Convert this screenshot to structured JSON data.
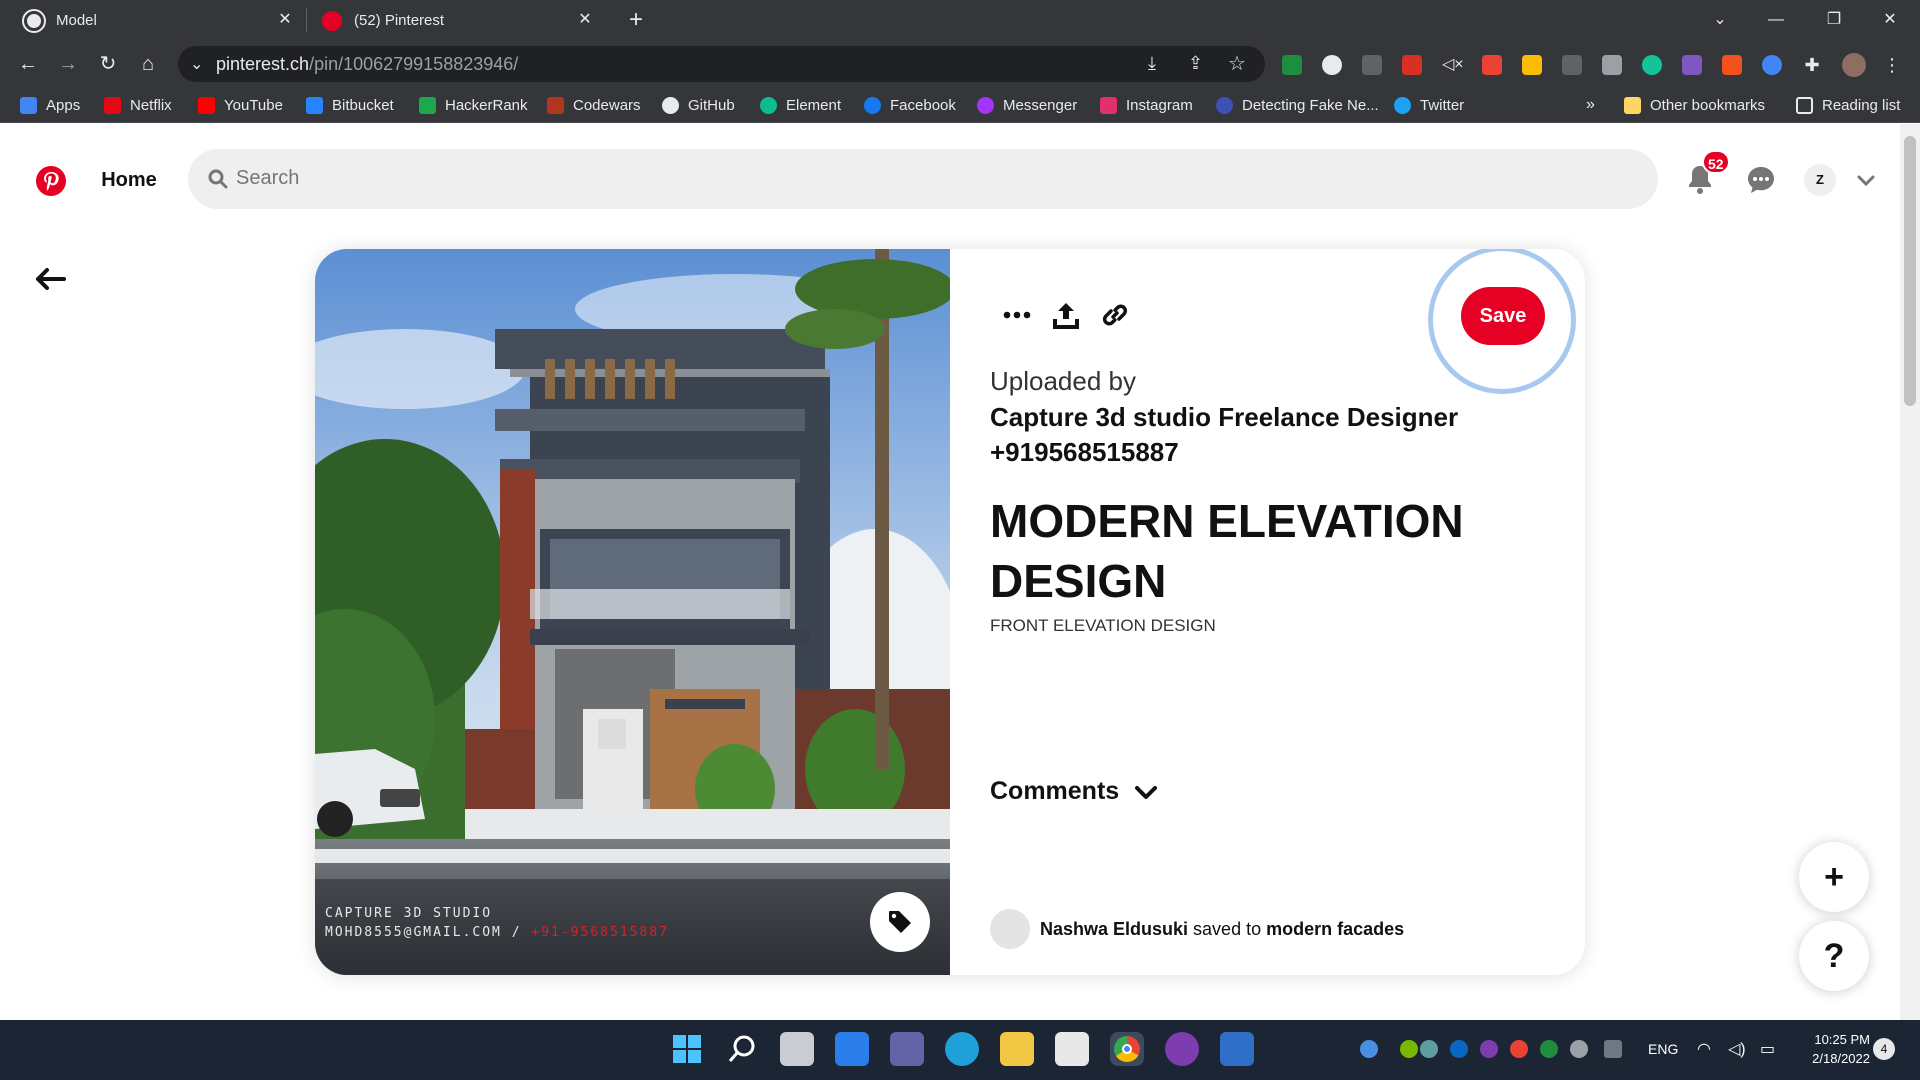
{
  "browser": {
    "tabs": [
      {
        "title": "Model",
        "close": "✕"
      },
      {
        "title": "(52) Pinterest",
        "close": "✕"
      }
    ],
    "new_tab": "+",
    "address": {
      "domain": "pinterest.ch",
      "path": "/pin/10062799158823946/"
    },
    "bookmarks": [
      {
        "label": "Apps",
        "color": "#4285f4"
      },
      {
        "label": "Netflix",
        "color": "#e50914"
      },
      {
        "label": "YouTube",
        "color": "#ff0000"
      },
      {
        "label": "Bitbucket",
        "color": "#2684ff"
      },
      {
        "label": "HackerRank",
        "color": "#1ba94c"
      },
      {
        "label": "Codewars",
        "color": "#b1361e"
      },
      {
        "label": "GitHub",
        "color": "#e8eaed"
      },
      {
        "label": "Element",
        "color": "#0dbd8b"
      },
      {
        "label": "Facebook",
        "color": "#1877f2"
      },
      {
        "label": "Messenger",
        "color": "#a334fa"
      },
      {
        "label": "Instagram",
        "color": "#e1306c"
      },
      {
        "label": "Detecting Fake Ne...",
        "color": "#3f51b5"
      },
      {
        "label": "Twitter",
        "color": "#1da1f2"
      }
    ],
    "more_bookmarks": "»",
    "other_bookmarks": "Other bookmarks",
    "reading_list": "Reading list"
  },
  "pinterest": {
    "nav": {
      "home": "Home",
      "search_placeholder": "Search",
      "notification_count": "52",
      "avatar_letter": "Z"
    },
    "pin": {
      "uploaded_by_label": "Uploaded by",
      "owner": "Capture 3d studio Freelance Designer +919568515887",
      "title": "MODERN ELEVATION DESIGN",
      "description": "FRONT ELEVATION DESIGN",
      "save_label": "Save",
      "comments_label": "Comments",
      "watermark_line1": "CAPTURE 3D STUDIO",
      "watermark_line2": "MOHD8555@GMAIL.COM / ",
      "watermark_phone": "+91-9568515887",
      "saver": {
        "name": "Nashwa Eldusuki",
        "saved_to_text": "saved to",
        "board": "modern facades"
      }
    },
    "fab_add": "+",
    "fab_help": "?"
  },
  "taskbar": {
    "language": "ENG",
    "time": "10:25 PM",
    "date": "2/18/2022",
    "notification_count": "4"
  },
  "colors": {
    "pinterest_red": "#e60023",
    "chrome_dark": "#35363a",
    "taskbar": "#1c2533"
  }
}
